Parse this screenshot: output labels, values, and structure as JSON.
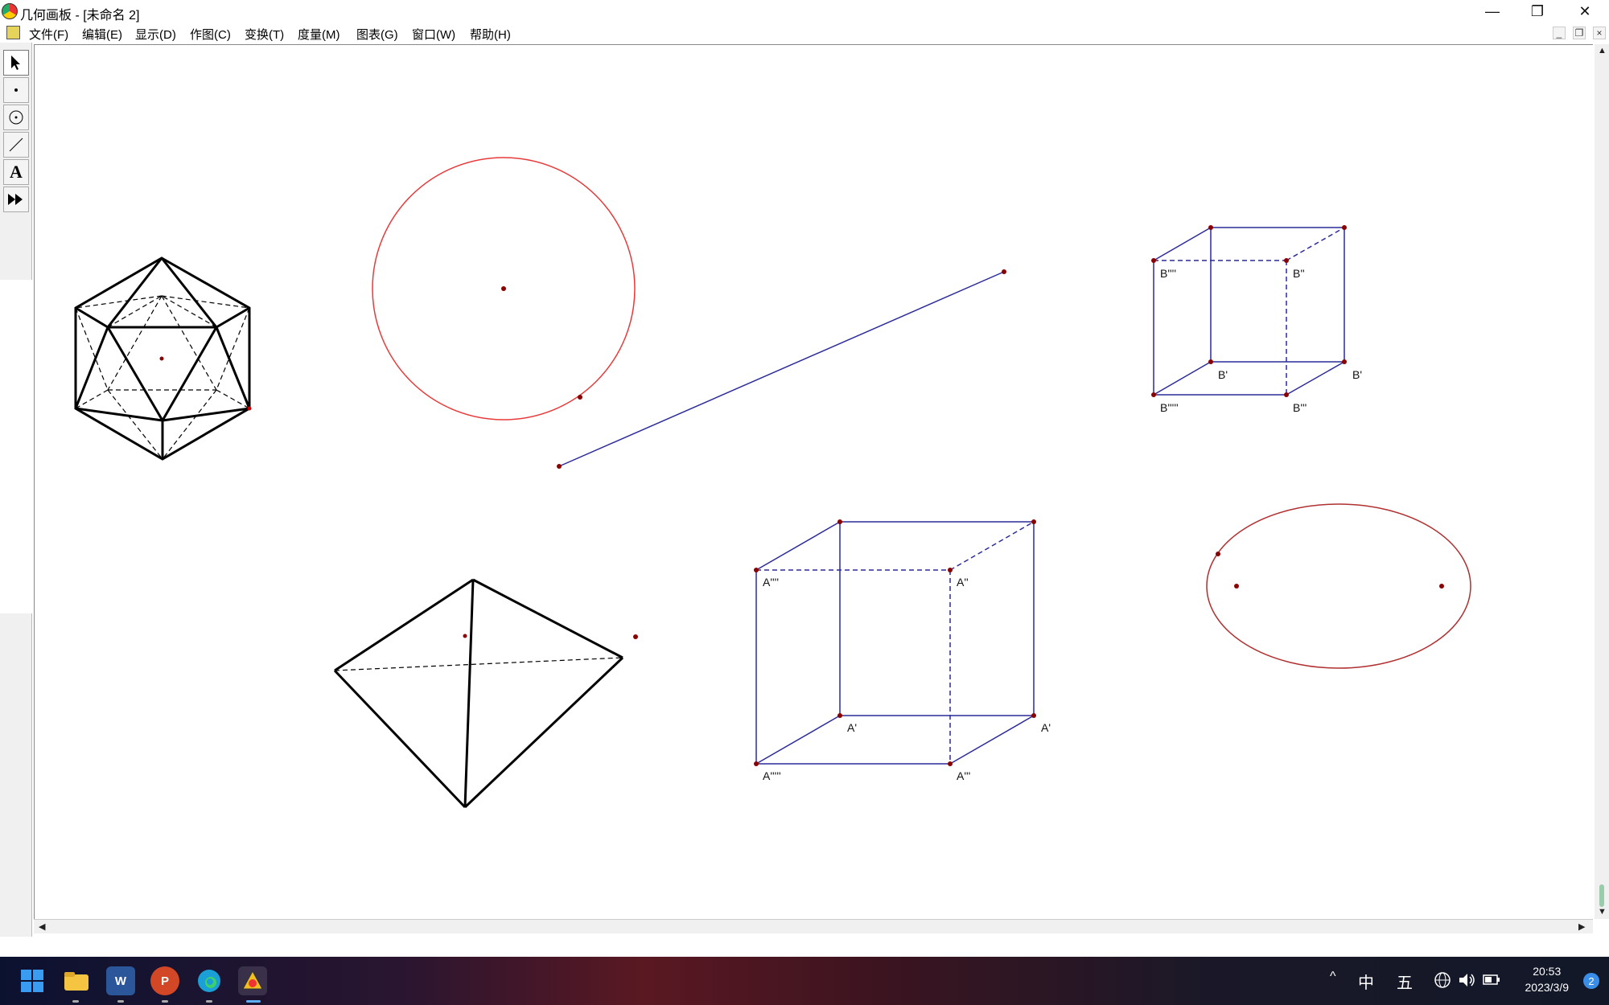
{
  "window": {
    "title": "几何画板 - [未命名 2]",
    "minimize_glyph": "—",
    "restore_glyph": "❐",
    "close_glyph": "✕"
  },
  "menu": {
    "items": [
      {
        "label": "文件(F)"
      },
      {
        "label": "编辑(E)"
      },
      {
        "label": "显示(D)"
      },
      {
        "label": "作图(C)"
      },
      {
        "label": "变换(T)"
      },
      {
        "label": "度量(M)"
      },
      {
        "label": "图表(G)"
      },
      {
        "label": "窗口(W)"
      },
      {
        "label": "帮助(H)"
      }
    ],
    "mdi_minimize": "_",
    "mdi_restore": "❐",
    "mdi_close": "×"
  },
  "toolbox": {
    "tools": [
      "arrow-select-tool",
      "point-tool",
      "compass-tool",
      "straightedge-tool",
      "text-tool",
      "custom-tool"
    ],
    "text_tool_glyph": "A"
  },
  "canvas": {
    "cube_b_labels": [
      "B''''",
      "B''",
      "B'",
      "B'",
      "B'''''",
      "B'''"
    ],
    "cube_a_labels": [
      "A''''",
      "A''",
      "A'",
      "A'",
      "A'''''",
      "A'''"
    ],
    "colors": {
      "red_circle": "#e83a3a",
      "blue_lines": "#2b2b9a",
      "ellipse": "#b03030",
      "solids": "#000000",
      "points": "#8b0000"
    }
  },
  "taskbar": {
    "apps": [
      "start-icon",
      "file-explorer-icon",
      "word-icon",
      "powerpoint-icon",
      "edge-icon",
      "geometers-sketchpad-icon"
    ],
    "word_letter": "W",
    "ppt_letter": "P",
    "tray": {
      "chevron": "^",
      "ime_lang": "中",
      "ime_mode": "五",
      "time": "20:53",
      "date": "2023/3/9",
      "notification_count": "2"
    }
  }
}
